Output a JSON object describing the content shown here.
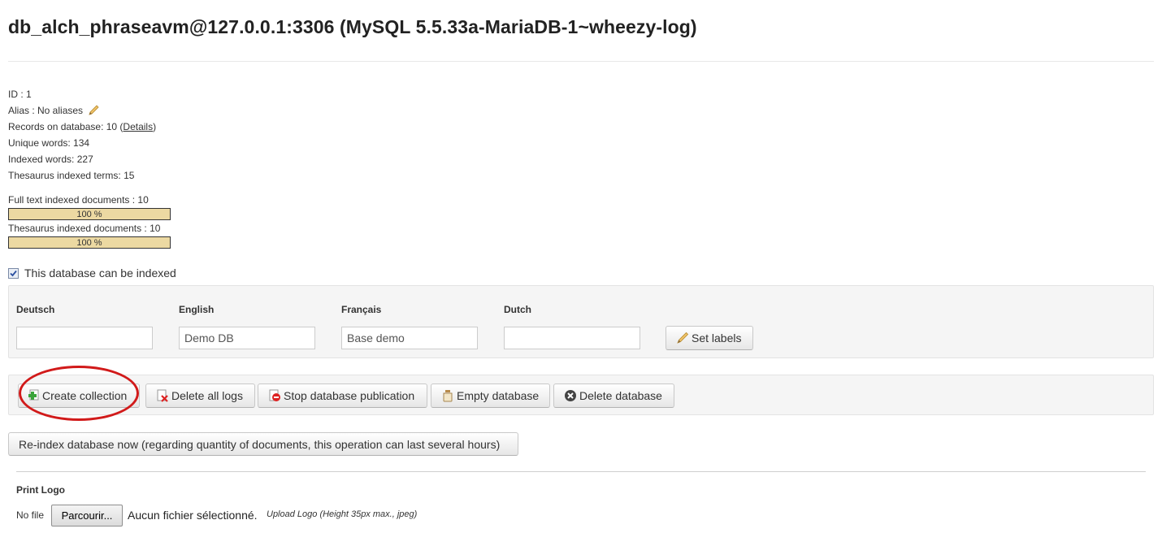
{
  "page": {
    "title": "db_alch_phraseavm@127.0.0.1:3306 (MySQL 5.5.33a-MariaDB-1~wheezy-log)"
  },
  "info": {
    "id_line": "ID : 1",
    "alias_line": "Alias : No aliases",
    "records_prefix": "Records on database: 10 (",
    "records_link": "Details",
    "records_suffix": ")",
    "unique_words": "Unique words: 134",
    "indexed_words": "Indexed words: 227",
    "thesaurus_terms": "Thesaurus indexed terms: 15"
  },
  "progress": {
    "fulltext_label": "Full text indexed documents : 10",
    "fulltext_value": 100,
    "fulltext_text": "100 %",
    "thesaurus_label": "Thesaurus indexed documents : 10",
    "thesaurus_value": 100,
    "thesaurus_text": "100 %"
  },
  "indexable": {
    "label": "This database can be indexed",
    "checked": true
  },
  "labels_form": {
    "languages": [
      {
        "label": "Deutsch",
        "value": ""
      },
      {
        "label": "English",
        "value": "Demo DB"
      },
      {
        "label": "Français",
        "value": "Base demo"
      },
      {
        "label": "Dutch",
        "value": ""
      }
    ],
    "set_labels_button": "Set labels"
  },
  "actions": {
    "create_collection": "Create collection",
    "delete_all_logs": "Delete all logs",
    "stop_publication": "Stop database publication",
    "empty_database": "Empty database",
    "delete_database": "Delete database"
  },
  "reindex_button": "Re-index database now (regarding quantity of documents, this operation can last several hours)",
  "print_logo": {
    "title": "Print Logo",
    "no_file": "No file",
    "browse_button": "Parcourir...",
    "no_file_selected": "Aucun fichier sélectionné.",
    "hint": "Upload Logo (Height 35px max., jpeg)"
  },
  "colors": {
    "progress_fill": "#ecd9a2",
    "highlight_oval": "#d11a1a"
  },
  "icons": {
    "alias_edit": "pencil-icon",
    "set_labels": "pencil-icon",
    "create_collection": "add-collection-icon",
    "delete_all_logs": "delete-logs-icon",
    "stop_publication": "stop-icon",
    "empty_database": "empty-jar-icon",
    "delete_database": "delete-circle-icon"
  }
}
